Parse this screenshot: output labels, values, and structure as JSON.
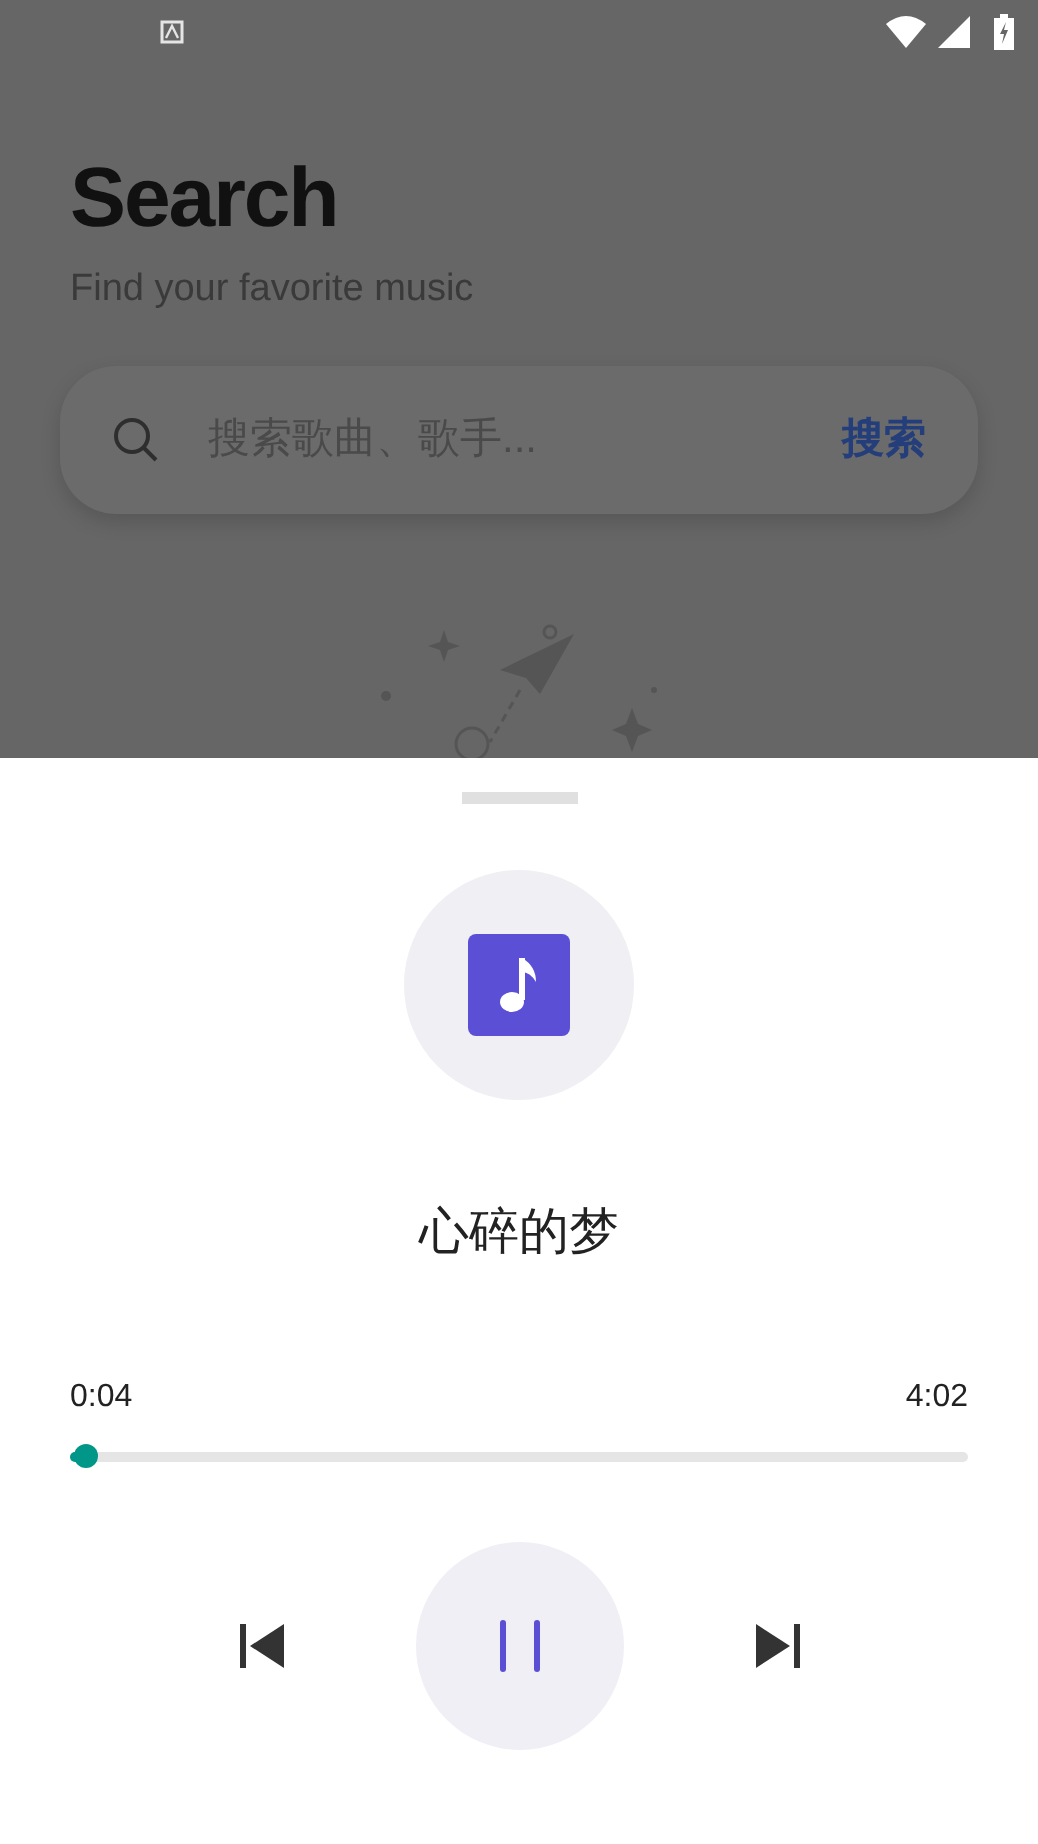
{
  "header": {
    "title": "Search",
    "subtitle": "Find your favorite music"
  },
  "search": {
    "placeholder": "搜索歌曲、歌手...",
    "button": "搜索"
  },
  "player": {
    "title": "心碎的梦",
    "elapsed": "0:04",
    "duration": "4:02",
    "level": 0.017,
    "playing": true
  }
}
